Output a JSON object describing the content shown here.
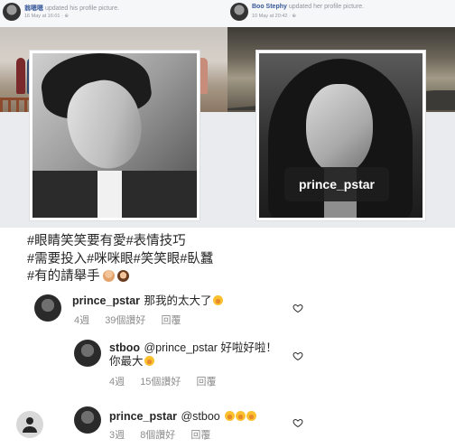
{
  "fb_posts": [
    {
      "author": "翁嗯嗯",
      "action": "updated his profile picture.",
      "timestamp": "16 May at 16:01 · ",
      "profile_tag": ""
    },
    {
      "author": "Boo Stephy",
      "action": "updated her profile picture.",
      "timestamp": "10 May at 20:42 · ",
      "profile_tag": "prince_pstar"
    }
  ],
  "caption": {
    "line1": "#眼睛笑笑要有愛#表情技巧",
    "line2": "#需要投入#咪咪眼#笑笑眼#臥蠶",
    "line3": "#有的請舉手"
  },
  "comments": [
    {
      "username": "prince_pstar",
      "text": "那我的太大了",
      "time": "4週",
      "likes": "39個讚好",
      "reply": "回覆"
    },
    {
      "username": "stboo",
      "text": "@prince_pstar 好啦好啦！",
      "text2": "你最大",
      "time": "4週",
      "likes": "15個讚好",
      "reply": "回覆"
    },
    {
      "username": "prince_pstar",
      "text": "@stboo",
      "time": "3週",
      "likes": "8個讚好",
      "reply": "回覆"
    }
  ],
  "icons": {
    "like": "heart-outline-icon",
    "self": "user-avatar-icon",
    "globe": "globe-icon"
  }
}
